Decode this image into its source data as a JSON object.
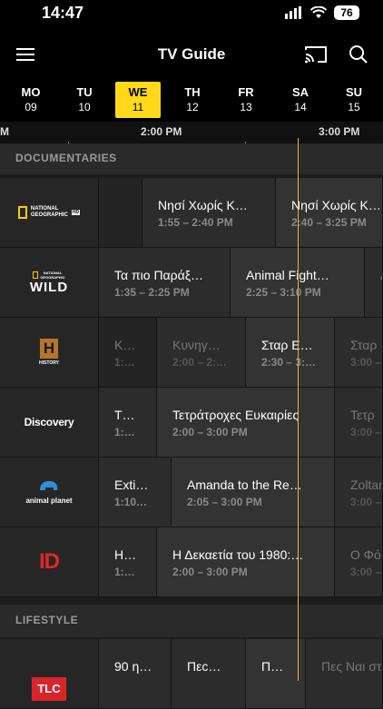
{
  "status": {
    "time": "14:47",
    "battery": "76"
  },
  "header": {
    "title": "TV Guide"
  },
  "icons": {
    "menu": "hamburger-menu-icon",
    "cast": "cast-icon",
    "search": "search-icon"
  },
  "colors": {
    "accent": "#ffd91a",
    "now_line": "#e2b93b"
  },
  "days": [
    {
      "name": "MO",
      "date": "09"
    },
    {
      "name": "TU",
      "date": "10"
    },
    {
      "name": "WE",
      "date": "11",
      "selected": true
    },
    {
      "name": "TH",
      "date": "12"
    },
    {
      "name": "FR",
      "date": "13"
    },
    {
      "name": "SA",
      "date": "14"
    },
    {
      "name": "SU",
      "date": "15"
    }
  ],
  "timeline": {
    "label_1": "2:00 PM",
    "label_2": "3:00 PM",
    "left_partial": "M"
  },
  "sections": [
    {
      "label": "DOCUMENTARIES"
    },
    {
      "label": "LIFESTYLE"
    }
  ],
  "channels": [
    {
      "logo": {
        "line1": "NATIONAL",
        "line2": "GEOGRAPHIC",
        "badge": "HD"
      },
      "programs": [
        {
          "title": "",
          "time": ""
        },
        {
          "title": "Νησί Χωρίς Κ…",
          "time": "1:55 – 2:40 PM"
        },
        {
          "title": "Νησί Χωρίς Κ…",
          "time": "2:40 – 3:25 PM"
        }
      ]
    },
    {
      "logo": {
        "line1": "NATIONAL",
        "line2": "GEOGRAPHIC",
        "main": "WILD"
      },
      "programs": [
        {
          "title": "Τα πιο Παράξ…",
          "time": "1:35 – 2:25 PM"
        },
        {
          "title": "Animal Fight…",
          "time": "2:25 – 3:10 PM"
        },
        {
          "title": "A",
          "time": ""
        }
      ]
    },
    {
      "logo": {
        "main": "H",
        "sub": "HISTORY"
      },
      "programs": [
        {
          "title": "Κ…",
          "time": "1:…"
        },
        {
          "title": "Κυνηγ…",
          "time": "2:00 – 2:…"
        },
        {
          "title": "Σταρ Ε…",
          "time": "2:30 – 3:…"
        },
        {
          "title": "Σταρ",
          "time": "3:00 –"
        }
      ]
    },
    {
      "logo": {
        "main": "Discovery"
      },
      "programs": [
        {
          "title": "Τ…",
          "time": "1:…"
        },
        {
          "title": "Τετράτροχες Ευκαιρίες",
          "time": "2:00 – 3:00 PM"
        },
        {
          "title": "Τετρ",
          "time": "3:00 –"
        }
      ]
    },
    {
      "logo": {
        "main": "animal planet"
      },
      "programs": [
        {
          "title": "Exti…",
          "time": "1:10…"
        },
        {
          "title": "Amanda to the Re…",
          "time": "2:05 – 3:00 PM"
        },
        {
          "title": "Zoltan",
          "time": "3:00 –"
        }
      ]
    },
    {
      "logo": {
        "main": "ID"
      },
      "programs": [
        {
          "title": "Η…",
          "time": "1:…"
        },
        {
          "title": "Η Δεκαετία του 1980:…",
          "time": "2:00 – 3:00 PM"
        },
        {
          "title": "Ο Φό",
          "time": "3:00 –"
        }
      ]
    },
    {
      "logo": {
        "main": "TLC"
      },
      "programs": [
        {
          "title": "90 η…",
          "time": ""
        },
        {
          "title": "Πεc…",
          "time": ""
        },
        {
          "title": "Π…",
          "time": ""
        },
        {
          "title": "Πες Ναι στ",
          "time": ""
        }
      ]
    }
  ]
}
